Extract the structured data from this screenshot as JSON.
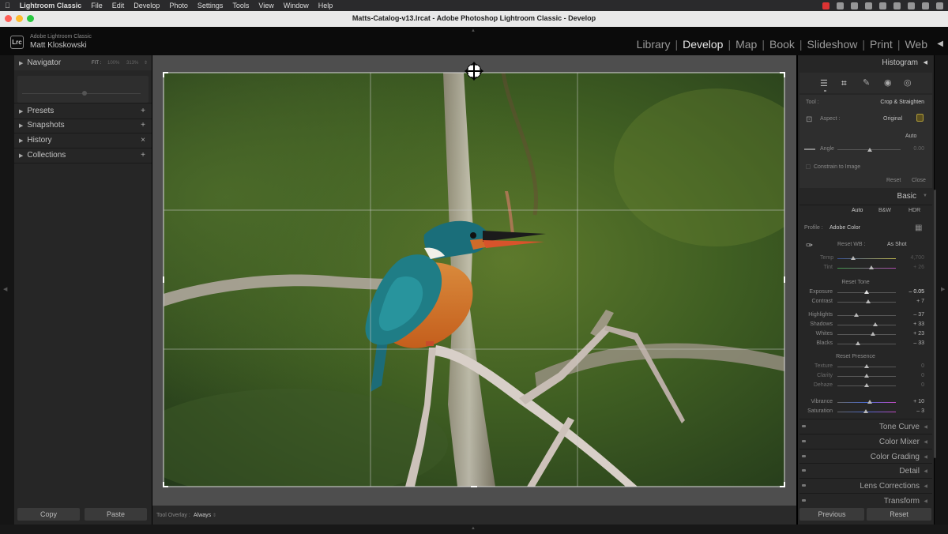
{
  "menubar": {
    "apple_icon": "apple-logo-icon",
    "items": [
      "Lightroom Classic",
      "File",
      "Edit",
      "Develop",
      "Photo",
      "Settings",
      "Tools",
      "View",
      "Window",
      "Help"
    ]
  },
  "window": {
    "title": "Matts-Catalog-v13.lrcat - Adobe Photoshop Lightroom Classic - Develop"
  },
  "identity": {
    "product": "Adobe Lightroom Classic",
    "user": "Matt Kloskowski",
    "logo": "Lrc"
  },
  "modules": [
    "Library",
    "Develop",
    "Map",
    "Book",
    "Slideshow",
    "Print",
    "Web"
  ],
  "active_module": "Develop",
  "left_panel": {
    "navigator": {
      "label": "Navigator",
      "zoom": [
        "FIT :",
        "100%",
        "313%"
      ]
    },
    "sections": [
      {
        "label": "Presets",
        "action": "+"
      },
      {
        "label": "Snapshots",
        "action": "+"
      },
      {
        "label": "History",
        "action": "×"
      },
      {
        "label": "Collections",
        "action": "+"
      }
    ],
    "copy": "Copy",
    "paste": "Paste"
  },
  "toolbar": {
    "label": "Tool Overlay :",
    "value": "Always"
  },
  "right_panel": {
    "histogram": "Histogram",
    "crop": {
      "tool_label": "Tool :",
      "tool_name": "Crop & Straighten",
      "aspect_label": "Aspect :",
      "aspect_value": "Original",
      "auto": "Auto",
      "angle_label": "Angle",
      "angle_value": "0.00",
      "constrain": "Constrain to Image",
      "reset": "Reset",
      "close": "Close"
    },
    "basic": {
      "title": "Basic",
      "treatments": [
        "Auto",
        "B&W",
        "HDR"
      ],
      "profile_label": "Profile :",
      "profile_value": "Adobe Color",
      "wb_label": "Reset WB :",
      "wb_value": "As Shot",
      "temp": {
        "label": "Temp",
        "value": "4,700"
      },
      "tint": {
        "label": "Tint",
        "value": "+ 26"
      },
      "tone_header": "Reset Tone",
      "exposure": {
        "label": "Exposure",
        "value": "– 0.05"
      },
      "contrast": {
        "label": "Contrast",
        "value": "+ 7"
      },
      "highlights": {
        "label": "Highlights",
        "value": "– 37"
      },
      "shadows": {
        "label": "Shadows",
        "value": "+ 33"
      },
      "whites": {
        "label": "Whites",
        "value": "+ 23"
      },
      "blacks": {
        "label": "Blacks",
        "value": "– 33"
      },
      "presence_header": "Reset Presence",
      "texture": {
        "label": "Texture",
        "value": "0"
      },
      "clarity": {
        "label": "Clarity",
        "value": "0"
      },
      "dehaze": {
        "label": "Dehaze",
        "value": "0"
      },
      "vibrance": {
        "label": "Vibrance",
        "value": "+ 10"
      },
      "saturation": {
        "label": "Saturation",
        "value": "– 3"
      }
    },
    "collapsed": [
      "Tone Curve",
      "Color Mixer",
      "Color Grading",
      "Detail",
      "Lens Corrections",
      "Transform"
    ],
    "previous": "Previous",
    "reset": "Reset"
  },
  "colors": {
    "accent": "#3a3a3a",
    "panel": "#262626",
    "canvas": "#4e4e4e"
  }
}
